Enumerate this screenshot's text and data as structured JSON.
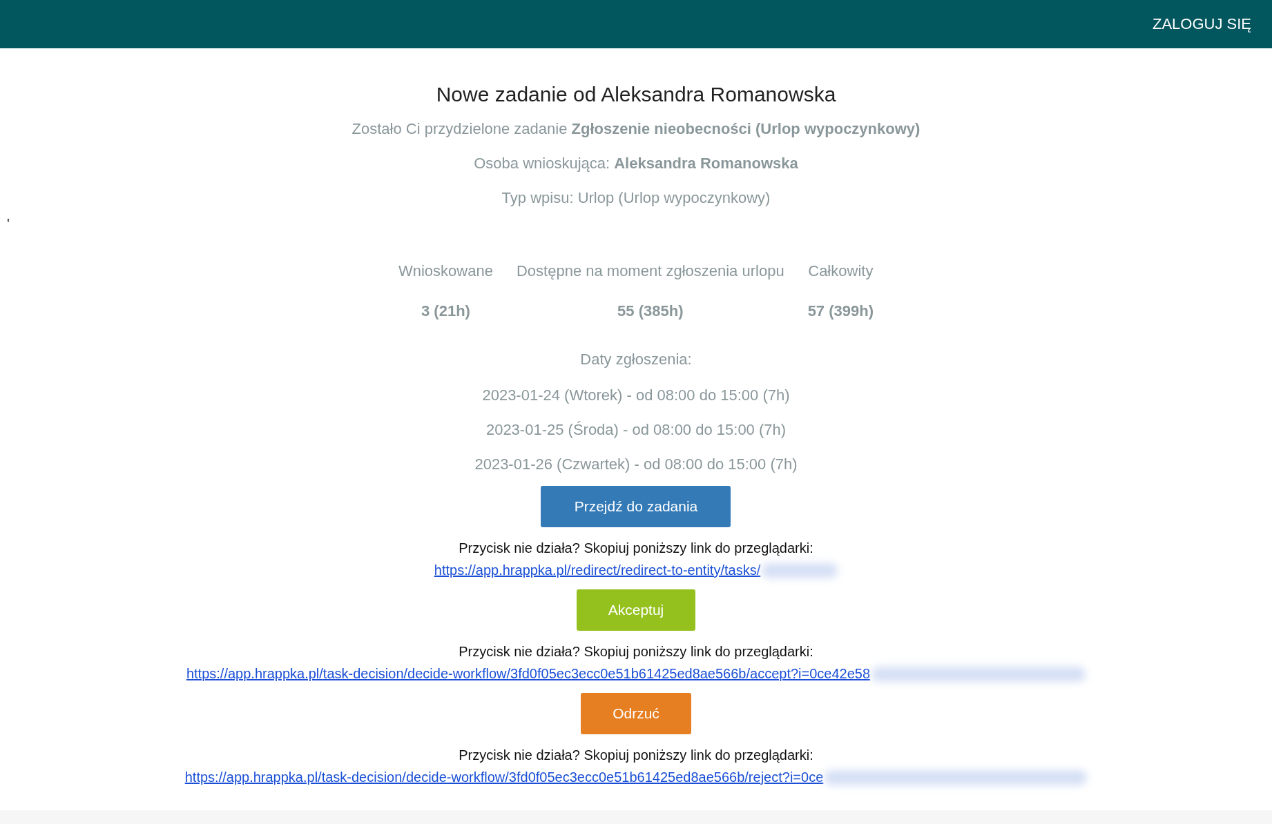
{
  "header": {
    "login_button": "ZALOGUJ SIĘ"
  },
  "stray_mark": "'",
  "title": "Nowe zadanie od Aleksandra Romanowska",
  "assignment": "Zostało Ci przydzielone zadanie **Zgłoszenie nieobecności (Urlop wypoczynkowy)**",
  "requester": "Osoba wnioskująca: **Aleksandra Romanowska**",
  "entry_type": "Typ wpisu: Urlop (Urlop wypoczynkowy)",
  "summary": {
    "columns": [
      "Wnioskowane",
      "Dostępne na moment zgłoszenia urlopu",
      "Całkowity"
    ],
    "values": [
      "3 (21h)",
      "55 (385h)",
      "57 (399h)"
    ]
  },
  "dates_label": "Daty zgłoszenia:",
  "dates": [
    "2023-01-24 (Wtorek) - od 08:00 do 15:00 (7h)",
    "2023-01-25 (Środa) - od 08:00 do 15:00 (7h)",
    "2023-01-26 (Czwartek) - od 08:00 do 15:00 (7h)"
  ],
  "actions": [
    {
      "kind": "open",
      "label": "Przejdź do zadania",
      "hint": "Przycisk nie działa? Skopiuj poniższy link do przeglądarki:",
      "link": "https://app.hrappka.pl/redirect/redirect-to-entity/tasks/",
      "redacted": true
    },
    {
      "kind": "accept",
      "label": "Akceptuj",
      "hint": "Przycisk nie działa? Skopiuj poniższy link do przeglądarki:",
      "link": "https://app.hrappka.pl/task-decision/decide-workflow/3fd0f05ec3ecc0e51b61425ed8ae566b/accept?i=0ce42e58",
      "redacted": true
    },
    {
      "kind": "reject",
      "label": "Odrzuć",
      "hint": "Przycisk nie działa? Skopiuj poniższy link do przeglądarki:",
      "link": "https://app.hrappka.pl/task-decision/decide-workflow/3fd0f05ec3ecc0e51b61425ed8ae566b/reject?i=0ce",
      "redacted": true
    }
  ]
}
